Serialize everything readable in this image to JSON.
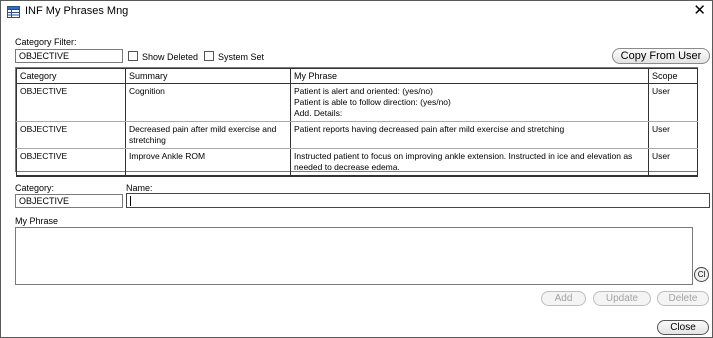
{
  "window": {
    "title": "INF My Phrases Mng",
    "close_glyph": "✕"
  },
  "filter": {
    "label": "Category Filter:",
    "value": "OBJECTIVE",
    "show_deleted_label": "Show Deleted",
    "show_deleted_checked": false,
    "system_set_label": "System Set",
    "system_set_checked": false,
    "copy_from_user_label": "Copy From User"
  },
  "grid": {
    "columns": [
      "Category",
      "Summary",
      "My Phrase",
      "Scope"
    ],
    "rows": [
      {
        "category": "OBJECTIVE",
        "summary": "Cognition",
        "phrase_lines": [
          "Patient is alert and oriented: (yes/no)",
          "Patient is able to follow direction: (yes/no)",
          "Add. Details:"
        ],
        "scope": "User"
      },
      {
        "category": "OBJECTIVE",
        "summary_lines": [
          "Decreased pain after mild exercise and",
          "stretching"
        ],
        "phrase": "Patient reports having decreased pain after mild exercise and stretching",
        "scope": "User"
      },
      {
        "category": "OBJECTIVE",
        "summary": "Improve Ankle ROM",
        "phrase_lines": [
          "Instructed patient to focus on improving ankle extension.  Instructed in ice and elevation as",
          "needed to decrease edema."
        ],
        "scope": "User"
      }
    ]
  },
  "editor": {
    "category_label": "Category:",
    "category_value": "OBJECTIVE",
    "name_label": "Name:",
    "name_value": "",
    "phrase_label": "My Phrase",
    "phrase_value": "",
    "cl_label": "Cl"
  },
  "actions": {
    "add": "Add",
    "update": "Update",
    "delete": "Delete",
    "close": "Close"
  },
  "icons": {
    "app": "table-window-icon"
  }
}
